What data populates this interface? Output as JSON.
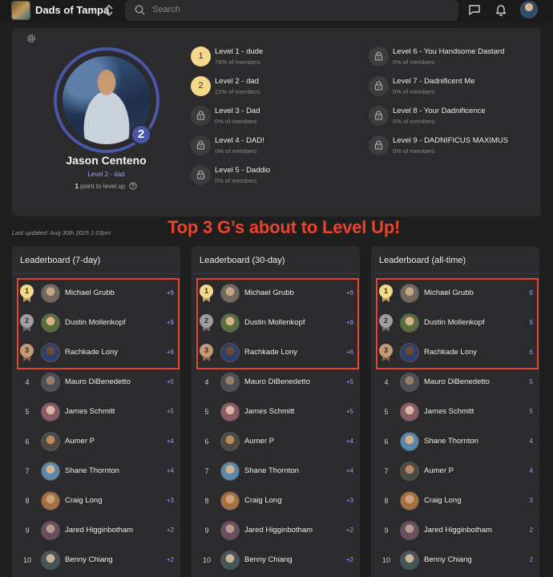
{
  "header": {
    "community_name": "Dads of Tampa",
    "search_placeholder": "Search"
  },
  "profile": {
    "name": "Jason Centeno",
    "level_badge": "2",
    "level_label": "Level 2 - dad",
    "points_to_level_up": "1",
    "points_suffix": "point to level up"
  },
  "levels": [
    {
      "badge": "1",
      "title": "Level 1 - dude",
      "members": "79% of members",
      "locked": false
    },
    {
      "badge": "2",
      "title": "Level 2 - dad",
      "members": "21% of members",
      "locked": false
    },
    {
      "badge": "",
      "title": "Level 3 - Dad",
      "members": "0% of members",
      "locked": true
    },
    {
      "badge": "",
      "title": "Level 4 - DAD!",
      "members": "0% of members",
      "locked": true
    },
    {
      "badge": "",
      "title": "Level 5 - Daddio",
      "members": "0% of members",
      "locked": true
    },
    {
      "badge": "",
      "title": "Level 6 - You Handsome Dastard",
      "members": "0% of members",
      "locked": true
    },
    {
      "badge": "",
      "title": "Level 7 - Dadnificent Me",
      "members": "0% of members",
      "locked": true
    },
    {
      "badge": "",
      "title": "Level 8 - Your Dadnificence",
      "members": "0% of members",
      "locked": true
    },
    {
      "badge": "",
      "title": "Level 9 - DADNIFICUS MAXIMUS",
      "members": "0% of members",
      "locked": true
    }
  ],
  "last_updated": "Last updated: Aug 30th 2025 1:03pm",
  "headline": "Top 3 G’s about to Level Up!",
  "leaderboards": [
    {
      "title": "Leaderboard (7-day)",
      "rows": [
        {
          "rank": "1",
          "name": "Michael Grubb",
          "points": "+9"
        },
        {
          "rank": "2",
          "name": "Dustin Mollenkopf",
          "points": "+9"
        },
        {
          "rank": "3",
          "name": "Rachkade Lony",
          "points": "+6"
        },
        {
          "rank": "4",
          "name": "Mauro DiBenedetto",
          "points": "+5"
        },
        {
          "rank": "5",
          "name": "James Schmitt",
          "points": "+5"
        },
        {
          "rank": "6",
          "name": "Aumer P",
          "points": "+4"
        },
        {
          "rank": "7",
          "name": "Shane Thornton",
          "points": "+4"
        },
        {
          "rank": "8",
          "name": "Craig Long",
          "points": "+3"
        },
        {
          "rank": "9",
          "name": "Jared Higginbotham",
          "points": "+2"
        },
        {
          "rank": "10",
          "name": "Benny Chiang",
          "points": "+2"
        }
      ]
    },
    {
      "title": "Leaderboard (30-day)",
      "rows": [
        {
          "rank": "1",
          "name": "Michael Grubb",
          "points": "+9"
        },
        {
          "rank": "2",
          "name": "Dustin Mollenkopf",
          "points": "+9"
        },
        {
          "rank": "3",
          "name": "Rachkade Lony",
          "points": "+6"
        },
        {
          "rank": "4",
          "name": "Mauro DiBenedetto",
          "points": "+5"
        },
        {
          "rank": "5",
          "name": "James Schmitt",
          "points": "+5"
        },
        {
          "rank": "6",
          "name": "Aumer P",
          "points": "+4"
        },
        {
          "rank": "7",
          "name": "Shane Thornton",
          "points": "+4"
        },
        {
          "rank": "8",
          "name": "Craig Long",
          "points": "+3"
        },
        {
          "rank": "9",
          "name": "Jared Higginbotham",
          "points": "+2"
        },
        {
          "rank": "10",
          "name": "Benny Chiang",
          "points": "+2"
        }
      ]
    },
    {
      "title": "Leaderboard (all-time)",
      "rows": [
        {
          "rank": "1",
          "name": "Michael Grubb",
          "points": "9"
        },
        {
          "rank": "2",
          "name": "Dustin Mollenkopf",
          "points": "9"
        },
        {
          "rank": "3",
          "name": "Rachkade Lony",
          "points": "6"
        },
        {
          "rank": "4",
          "name": "Mauro DiBenedetto",
          "points": "5"
        },
        {
          "rank": "5",
          "name": "James Schmitt",
          "points": "5"
        },
        {
          "rank": "6",
          "name": "Shane Thornton",
          "points": "4"
        },
        {
          "rank": "7",
          "name": "Aumer P",
          "points": "4"
        },
        {
          "rank": "8",
          "name": "Craig Long",
          "points": "3"
        },
        {
          "rank": "9",
          "name": "Jared Higginbotham",
          "points": "2"
        },
        {
          "rank": "10",
          "name": "Benny Chiang",
          "points": "2"
        }
      ]
    }
  ],
  "colors": {
    "accent": "#8ea3ff",
    "level_ring": "#4a57a8",
    "highlight": "#e8452c",
    "gold": "#f5d88a"
  }
}
